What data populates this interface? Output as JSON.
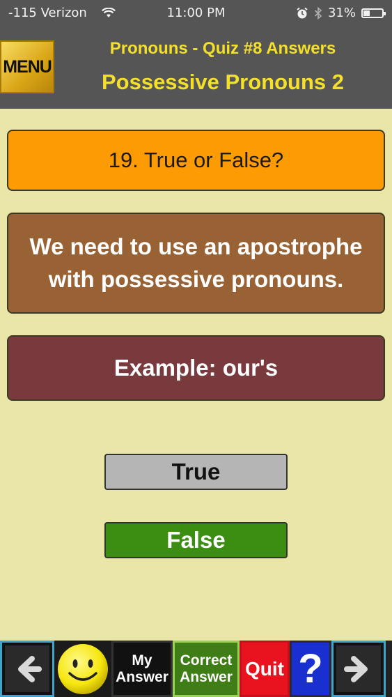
{
  "status_bar": {
    "carrier": "-115 Verizon",
    "time": "11:00 PM",
    "battery": "31%",
    "battery_level": 0.31
  },
  "header": {
    "menu_label": "MENU",
    "title": "Pronouns - Quiz #8 Answers",
    "subtitle": "Possessive Pronouns 2"
  },
  "question": {
    "number_label": "19. True or False?",
    "statement": "We need to use an apostrophe with possessive pronouns.",
    "example": "Example: our's"
  },
  "answers": {
    "true_label": "True",
    "false_label": "False"
  },
  "toolbar": {
    "my_answer_line1": "My",
    "my_answer_line2": "Answer",
    "correct_answer_line1": "Correct",
    "correct_answer_line2": "Answer",
    "quit_label": "Quit",
    "help_label": "?"
  },
  "icons": {
    "back": "left-arrow-icon",
    "forward": "right-arrow-icon",
    "feedback": "smiley-face-icon",
    "wifi": "wifi-icon",
    "alarm": "alarm-icon",
    "bluetooth": "bluetooth-icon",
    "battery": "battery-icon"
  },
  "colors": {
    "background": "#e9e6a7",
    "header": "#555555",
    "header_text": "#f4e02a",
    "question_box": "#fd9b05",
    "statement_box": "#996235",
    "example_box": "#793a3d",
    "true_button": "#b5b5b6",
    "false_button": "#3b8e12",
    "quit_button": "#e8131e",
    "help_button": "#1a2fd0"
  }
}
